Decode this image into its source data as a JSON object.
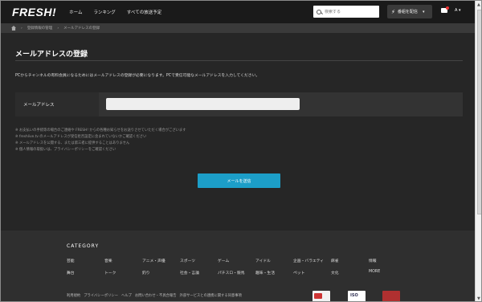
{
  "header": {
    "logo": "FRESH!",
    "nav": [
      "ホーム",
      "ランキング",
      "すべての放送予定"
    ],
    "search_placeholder": "検索する",
    "broadcast_label": "番組を配信",
    "user_initial": "A"
  },
  "breadcrumb": {
    "items": [
      "登録情報の管理",
      "メールアドレスの登録"
    ]
  },
  "page": {
    "title": "メールアドレスの登録",
    "description": "PCからチャンネルの有料会員になるためにはメールアドレスの登録が必要になります。PCで受信可能なメールアドレスを入力してください。",
    "field_label": "メールアドレス",
    "field_value": "",
    "notes": [
      "※ お支払いの手続等の場合のご連絡や FRESH! からの各種お知らせをお送りさせていただく場合がございます",
      "※ freshlive.tv のメールアドレスが受信拒否設定に含まれていないかご確認ください",
      "※ メールアドレスを公開する、または第三者に提供することはありません",
      "※ 個人情報の取扱いは、プライバシーポリシーをご確認ください"
    ],
    "submit_label": "メールを送信"
  },
  "footer": {
    "category_title": "CATEGORY",
    "categories": [
      "芸能",
      "音楽",
      "アニメ・声優",
      "スポーツ",
      "ゲーム",
      "アイドル",
      "企画・バラエティ",
      "麻雀",
      "情報",
      "舞台",
      "トーク",
      "釣り",
      "社会・言論",
      "パチスロ・競馬",
      "趣味・生活",
      "ペット",
      "文化",
      "MORE"
    ],
    "links": [
      "利用規約",
      "プライバシーポリシー",
      "ヘルプ",
      "お問い合わせ・不具合報告",
      "外部サービスとの連携に関する同意事項"
    ]
  },
  "colors": {
    "accent": "#1c9ec8",
    "background": "#262626",
    "header": "#1a1a1a"
  }
}
